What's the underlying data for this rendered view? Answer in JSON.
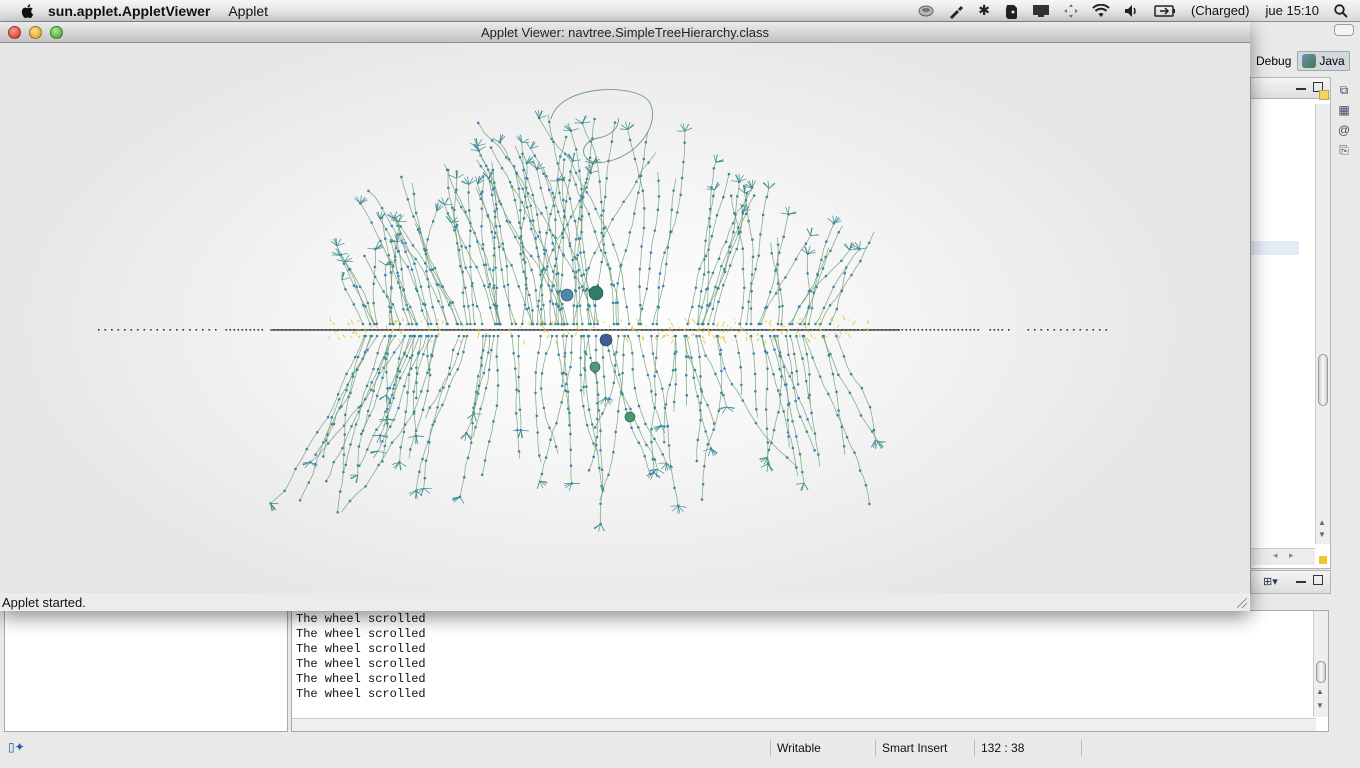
{
  "menubar": {
    "app_name": "sun.applet.AppletViewer",
    "menus": [
      "Applet"
    ],
    "battery_text": "(Charged)",
    "clock": "jue 15:10",
    "status_icons": [
      "coffee-cup-icon",
      "pen-tool-icon",
      "bluetooth-icon",
      "evernote-icon",
      "display-icon",
      "move-arrows-icon",
      "wifi-icon",
      "volume-icon",
      "battery-icon",
      "spotlight-icon"
    ]
  },
  "applet": {
    "window_title": "Applet Viewer: navtree.SimpleTreeHierarchy.class",
    "status": "Applet started.",
    "colors": {
      "branch": "#6f9a78",
      "node": "#3f8c8f",
      "blue_node": "#3c7fc7",
      "yellow": "#e6cf52",
      "axis": "#333333"
    }
  },
  "ide": {
    "perspectives": [
      "Debug",
      "Java"
    ],
    "console_lines": [
      "The wheel scrolled",
      "The wheel scrolled",
      "The wheel scrolled",
      "The wheel scrolled",
      "The wheel scrolled",
      "The wheel scrolled"
    ],
    "status": {
      "mode": "Writable",
      "insert": "Smart Insert",
      "position": "132 : 38"
    }
  }
}
